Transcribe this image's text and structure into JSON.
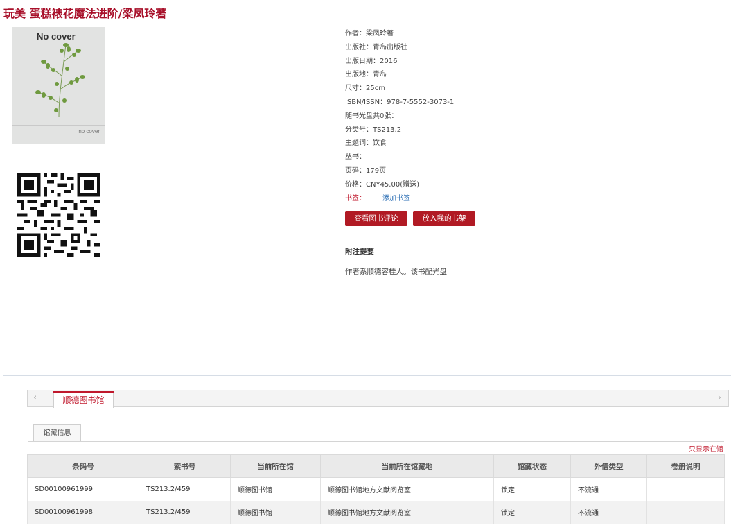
{
  "title": "玩美 蛋糕裱花魔法进阶/梁凤玲著",
  "cover": {
    "title": "No cover",
    "small": "no cover"
  },
  "meta": [
    {
      "key": "author",
      "text": "作者：梁凤玲著"
    },
    {
      "key": "publisher",
      "text": "出版社：青岛出版社"
    },
    {
      "key": "pubdate",
      "text": "出版日期：2016"
    },
    {
      "key": "pubplace",
      "text": "出版地：青岛"
    },
    {
      "key": "size",
      "text": "尺寸：25cm"
    },
    {
      "key": "isbn",
      "text": "ISBN/ISSN：978-7-5552-3073-1"
    },
    {
      "key": "disc",
      "text": "随书光盘共0张："
    },
    {
      "key": "classno",
      "text": "分类号：TS213.2"
    },
    {
      "key": "subject",
      "text": "主题词：饮食"
    },
    {
      "key": "series",
      "text": "丛书："
    },
    {
      "key": "pages",
      "text": "页码：179页"
    },
    {
      "key": "price",
      "text": "价格：CNY45.00(赠送)"
    }
  ],
  "bookmark": {
    "label": "书签：",
    "link": "添加书签"
  },
  "buttons": {
    "review": "查看图书评论",
    "shelf": "放入我的书架"
  },
  "notes": {
    "heading": "附注提要",
    "text": "作者系顺德容桂人。该书配光盘"
  },
  "library_tab": "顺德图书馆",
  "holdings_tab": "馆藏信息",
  "only_available": "只显示在馆",
  "table": {
    "headers": [
      "条码号",
      "索书号",
      "当前所在馆",
      "当前所在馆藏地",
      "馆藏状态",
      "外借类型",
      "卷册说明"
    ],
    "rows": [
      [
        "SD00100961999",
        "TS213.2/459",
        "顺德图书馆",
        "顺德图书馆地方文献阅览室",
        "锁定",
        "不流通",
        ""
      ],
      [
        "SD00100961998",
        "TS213.2/459",
        "顺德图书馆",
        "顺德图书馆地方文献阅览室",
        "锁定",
        "不流通",
        ""
      ]
    ]
  },
  "icons": {
    "left": "chevron-left-icon",
    "right": "chevron-right-icon"
  },
  "colors": {
    "accent": "#b11a24",
    "title": "#a8102a",
    "link": "#2c6fb5"
  }
}
